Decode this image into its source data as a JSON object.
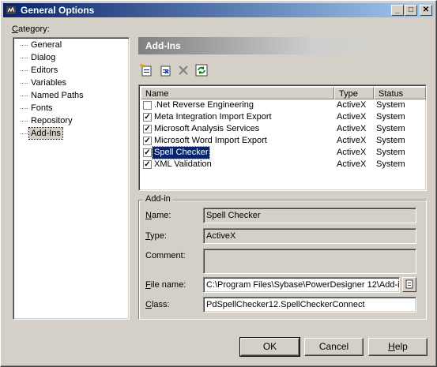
{
  "window": {
    "title": "General Options",
    "controls": {
      "minimize": "_",
      "maximize": "□",
      "close": "✕"
    }
  },
  "category": {
    "label": "Category:",
    "items": [
      {
        "label": "General"
      },
      {
        "label": "Dialog"
      },
      {
        "label": "Editors"
      },
      {
        "label": "Variables"
      },
      {
        "label": "Named Paths"
      },
      {
        "label": "Fonts"
      },
      {
        "label": "Repository"
      },
      {
        "label": "Add-Ins",
        "selected": true
      }
    ]
  },
  "panel": {
    "title": "Add-Ins",
    "toolbar_icons": [
      "new-addin-icon",
      "add-addin-icon",
      "delete-icon",
      "refresh-icon"
    ]
  },
  "addins": {
    "columns": [
      "Name",
      "Type",
      "Status"
    ],
    "rows": [
      {
        "name": ".Net Reverse Engineering",
        "type": "ActiveX",
        "status": "System",
        "checked": false
      },
      {
        "name": "Meta Integration Import Export",
        "type": "ActiveX",
        "status": "System",
        "checked": true
      },
      {
        "name": "Microsoft Analysis Services",
        "type": "ActiveX",
        "status": "System",
        "checked": true
      },
      {
        "name": "Microsoft Word Import Export",
        "type": "ActiveX",
        "status": "System",
        "checked": true
      },
      {
        "name": "Spell Checker",
        "type": "ActiveX",
        "status": "System",
        "checked": true,
        "selected": true
      },
      {
        "name": "XML Validation",
        "type": "ActiveX",
        "status": "System",
        "checked": true
      }
    ]
  },
  "details": {
    "group_label": "Add-in",
    "name_label": "Name:",
    "name_value": "Spell Checker",
    "type_label": "Type:",
    "type_value": "ActiveX",
    "comment_label": "Comment:",
    "comment_value": "",
    "file_label": "File name:",
    "file_value": "C:\\Program Files\\Sybase\\PowerDesigner 12\\Add-in",
    "class_label": "Class:",
    "class_value": "PdSpellChecker12.SpellCheckerConnect"
  },
  "buttons": {
    "ok": "OK",
    "cancel": "Cancel",
    "help": "Help"
  },
  "colors": {
    "title_start": "#0a246a",
    "title_end": "#a6caf0",
    "selection": "#0a246a",
    "face": "#d4d0c8"
  }
}
